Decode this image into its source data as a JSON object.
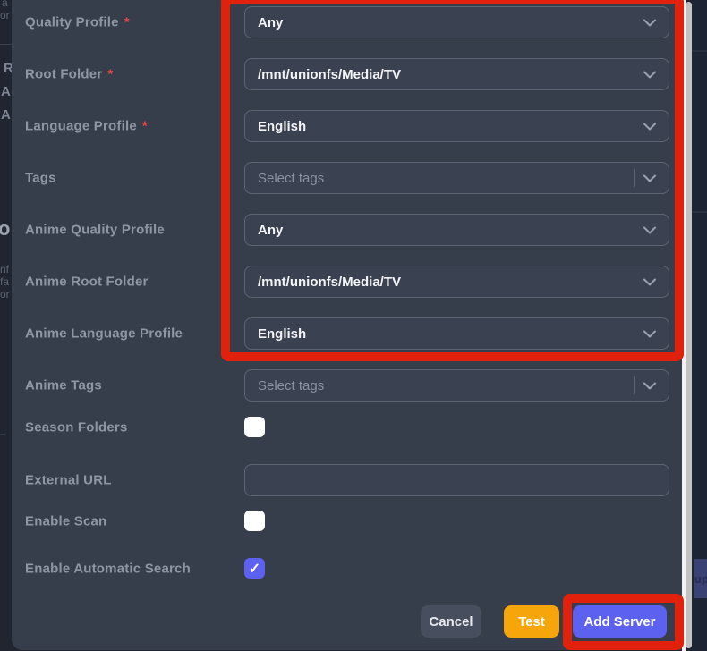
{
  "colors": {
    "modal_bg": "#363d4b",
    "backdrop_left": "#20252f",
    "backdrop_right": "#1d2433",
    "label": "#8e96a5",
    "field_border": "#5d6575",
    "field_bg": "#3a4150",
    "field_text": "#f3f4f6",
    "placeholder_text": "#8a93a2",
    "required_red": "#ef4444",
    "annotation_red": "#e2210c",
    "checkbox_checked": "#5d61f0",
    "button_cancel": "#474f5e",
    "button_test": "#f6a50b",
    "button_add_server": "#5d61f0",
    "scrollbar_track": "#f2f2f2",
    "scrollbar_thumb": "#c2c2c2"
  },
  "icons": {
    "chevron_down": "chevron-down",
    "checkmark": "✓"
  },
  "form": {
    "required_marker": "*",
    "fields": [
      {
        "label": "Quality Profile",
        "required": true,
        "type": "select",
        "value": "Any"
      },
      {
        "label": "Root Folder",
        "required": true,
        "type": "select",
        "value": "/mnt/unionfs/Media/TV"
      },
      {
        "label": "Language Profile",
        "required": true,
        "type": "select",
        "value": "English"
      },
      {
        "label": "Tags",
        "type": "multiselect",
        "placeholder": "Select tags"
      },
      {
        "label": "Anime Quality Profile",
        "type": "select",
        "value": "Any"
      },
      {
        "label": "Anime Root Folder",
        "type": "select",
        "value": "/mnt/unionfs/Media/TV"
      },
      {
        "label": "Anime Language Profile",
        "type": "select",
        "value": "English"
      },
      {
        "label": "Anime Tags",
        "type": "multiselect",
        "placeholder": "Select tags"
      },
      {
        "label": "Season Folders",
        "type": "checkbox",
        "checked": false
      },
      {
        "label": "External URL",
        "type": "text",
        "value": ""
      },
      {
        "label": "Enable Scan",
        "type": "checkbox",
        "checked": false
      },
      {
        "label": "Enable Automatic Search",
        "type": "checkbox",
        "checked": true
      }
    ]
  },
  "footer": {
    "cancel_label": "Cancel",
    "test_label": "Test",
    "add_server_label": "Add Server"
  },
  "background": {
    "left_fragments": [
      "a",
      "or",
      "R",
      "A",
      "A",
      "o",
      "nf",
      "fa",
      "or",
      "–"
    ],
    "right_fragment": "up"
  }
}
